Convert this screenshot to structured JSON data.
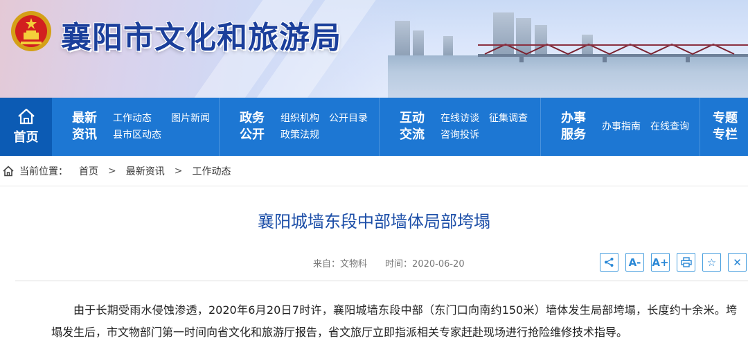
{
  "site": {
    "title": "襄阳市文化和旅游局"
  },
  "nav": {
    "home_label": "首页",
    "sections": [
      {
        "head": "最新资讯",
        "links": [
          "工作动态",
          "图片新闻",
          "县市区动态"
        ]
      },
      {
        "head": "政务公开",
        "links": [
          "组织机构",
          "公开目录",
          "政策法规"
        ]
      },
      {
        "head": "互动交流",
        "links": [
          "在线访谈",
          "征集调查",
          "咨询投诉"
        ]
      },
      {
        "head": "办事服务",
        "links": [
          "办事指南",
          "在线查询"
        ]
      }
    ],
    "last_head": "专题专栏"
  },
  "breadcrumb": {
    "prefix": "当前位置：",
    "items": [
      "首页",
      "最新资讯",
      "工作动态"
    ],
    "separator": ">"
  },
  "article": {
    "title": "襄阳城墙东段中部墙体局部垮塌",
    "source_label": "来自：",
    "source": "文物科",
    "time_label": "时间：",
    "time": "2020-06-20",
    "body": "由于长期受雨水侵蚀渗透，2020年6月20日7时许，襄阳城墙东段中部（东门口向南约150米）墙体发生局部垮塌，长度约十余米。垮塌发生后，市文物部门第一时间向省文化和旅游厅报告，省文旅厅立即指派相关专家赶赴现场进行抢险维修技术指导。"
  },
  "tools": [
    {
      "icon": "share-icon",
      "glyph": "⋖"
    },
    {
      "icon": "font-decrease-icon",
      "glyph": "A-"
    },
    {
      "icon": "font-increase-icon",
      "glyph": "A+"
    },
    {
      "icon": "print-icon",
      "glyph": "⎙"
    },
    {
      "icon": "favorite-star-icon",
      "glyph": "☆"
    },
    {
      "icon": "close-icon",
      "glyph": "✕"
    }
  ],
  "colors": {
    "nav": "#1d77d3",
    "nav_home": "#0c5bb4",
    "title": "#1d4fa8",
    "tool_border": "#4aa0df"
  }
}
